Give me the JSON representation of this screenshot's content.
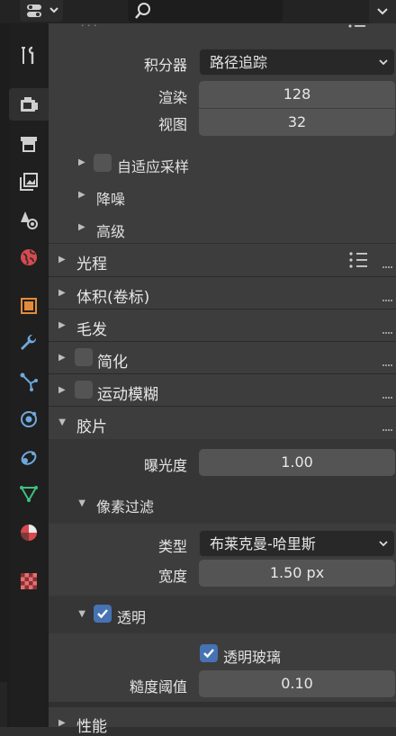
{
  "header": {
    "editor_icon": "properties-editor-icon",
    "search_icon": "search-icon",
    "search_placeholder": "",
    "options_icon": "chevron-down-icon"
  },
  "sidebar": {
    "tabs": [
      {
        "name": "tool",
        "icon": "wrench-screwdriver-icon"
      },
      {
        "name": "render",
        "icon": "camera-back-icon",
        "active": true
      },
      {
        "name": "output",
        "icon": "printer-icon"
      },
      {
        "name": "view-layer",
        "icon": "image-stack-icon"
      },
      {
        "name": "scene",
        "icon": "scene-cone-sphere-icon"
      },
      {
        "name": "world",
        "icon": "world-globe-icon"
      },
      {
        "name": "object",
        "icon": "object-square-icon"
      },
      {
        "name": "modifier",
        "icon": "wrench-icon"
      },
      {
        "name": "particles",
        "icon": "particles-icon"
      },
      {
        "name": "physics",
        "icon": "physics-orbit-icon"
      },
      {
        "name": "constraints",
        "icon": "constraint-icon"
      },
      {
        "name": "data",
        "icon": "mesh-data-triangle-icon"
      },
      {
        "name": "material",
        "icon": "material-sphere-icon"
      },
      {
        "name": "texture",
        "icon": "checkerboard-texture-icon"
      }
    ]
  },
  "sampling": {
    "top_partial": "· · ·",
    "integrator_label": "积分器",
    "integrator_value": "路径追踪",
    "render_label": "渲染",
    "render_value": "128",
    "viewport_label": "视图",
    "viewport_value": "32",
    "adaptive_label": "自适应采样",
    "denoise_label": "降噪",
    "advanced_label": "高级"
  },
  "panels": {
    "light_paths": "光程",
    "volumes": "体积(卷标)",
    "hair": "毛发",
    "simplify": "简化",
    "motion_blur": "运动模糊",
    "film": "胶片",
    "performance": "性能"
  },
  "film": {
    "exposure_label": "曝光度",
    "exposure_value": "1.00",
    "pixel_filter_label": "像素过滤",
    "type_label": "类型",
    "type_value": "布莱克曼-哈里斯",
    "width_label": "宽度",
    "width_value": "1.50 px",
    "transparent_label": "透明",
    "transparent_checked": true,
    "transparent_glass_label": "透明玻璃",
    "transparent_glass_checked": true,
    "roughness_label": "糙度阈值",
    "roughness_value": "0.10"
  },
  "colors": {
    "accent_blue": "#4772b3",
    "field_bg": "#545454",
    "panel_header": "#3d3d3d",
    "background": "#303030"
  }
}
